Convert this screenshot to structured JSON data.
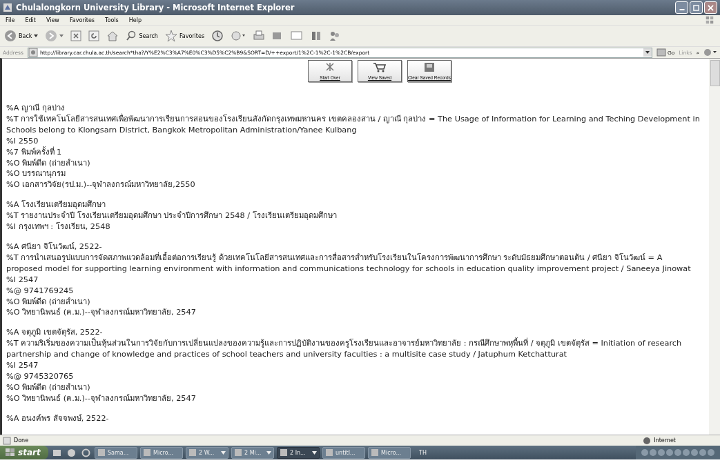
{
  "window": {
    "title": "Chulalongkorn University Library - Microsoft Internet Explorer"
  },
  "menu": [
    "File",
    "Edit",
    "View",
    "Favorites",
    "Tools",
    "Help"
  ],
  "toolbar": {
    "back": "Back",
    "search": "Search",
    "favorites": "Favorites"
  },
  "address": {
    "label": "Address",
    "url": "http://library.car.chula.ac.th/search*tha?/Y%E2%C3%A7%E0%C3%D5%C2%B9&SORT=D/++export/1%2C-1%2C-1%2CB/export",
    "go": "Go",
    "links": "Links",
    "more": "»"
  },
  "page_buttons": [
    {
      "kind": "start",
      "label": "Start Over"
    },
    {
      "kind": "cart",
      "label": "View Saved"
    },
    {
      "kind": "clear",
      "label": "Clear Saved Records"
    }
  ],
  "records": [
    {
      "lines": [
        "%A ญาณี กุลบ่าง",
        "%T การใช้เทคโนโลยีสารสนเทศเพื่อพัฒนาการเรียนการสอนของโรงเรียนสังกัดกรุงเทพมหานคร เขตคลองสาน / ญาณี กุลบ่าง = The Usage of Information for Learning and Teching Development in Schools belong to Klongsarn District, Bangkok Metropolitan Administration/Yanee Kulbang",
        "%I 2550",
        "%7 พิมพ์ครั้งที่ 1",
        "%O พิมพ์ดีด (ถ่ายสำเนา)",
        "%O บรรณานุกรม",
        "%O เอกสารวิจัย(รป.ม.)--จุฬาลงกรณ์มหาวิทยาลัย,2550"
      ]
    },
    {
      "lines": [
        "%A โรงเรียนเตรียมอุดมศึกษา",
        "%T รายงานประจำปี โรงเรียนเตรียมอุดมศึกษา ประจำปีการศึกษา 2548 / โรงเรียนเตรียมอุดมศึกษา",
        "%I กรุงเทพฯ : โรงเรียน, 2548"
      ]
    },
    {
      "lines": [
        "%A ศนียา จิโนวัฒน์, 2522-",
        "%T การนำเสนอรูปแบบการจัดสภาพแวดล้อมที่เอื้อต่อการเรียนรู้ ด้วยเทคโนโลยีสารสนเทศและการสื่อสารสำหรับโรงเรียนในโครงการพัฒนาการศึกษา ระดับมัธยมศึกษาตอนต้น / ศนียา จิโนวัฒน์ = A proposed model for supporting learning environment with information and communications technology for schools in education quality improvement project / Saneeya Jinowat",
        "%I 2547",
        "%@ 9741769245",
        "%O พิมพ์ดีด (ถ่ายสำเนา)",
        "%O วิทยานิพนธ์ (ค.ม.)--จุฬาลงกรณ์มหาวิทยาลัย, 2547"
      ]
    },
    {
      "lines": [
        "%A จตุภูมิ เขตจัตุรัส, 2522-",
        "%T ความริเริ่มของความเป็นหุ้นส่วนในการวิจัยกับการเปลี่ยนแปลงของความรู้และการปฏิบัติงานของครูโรงเรียนและอาจารย์มหาวิทยาลัย : กรณีศึกษาพหุพื้นที่ / จตุภูมิ เขตจัตุรัส = Initiation of research partnership and change of knowledge and practices of school teachers and university faculties : a multisite case study / Jatuphum Ketchatturat",
        "%I 2547",
        "%@ 9745320765",
        "%O พิมพ์ดีด (ถ่ายสำเนา)",
        "%O วิทยานิพนธ์ (ค.ม.)--จุฬาลงกรณ์มหาวิทยาลัย, 2547"
      ]
    },
    {
      "lines": [
        "%A อนงค์พร สัจจพงษ์, 2522-"
      ]
    }
  ],
  "status_bar": {
    "text": "Done",
    "zone": "Internet"
  },
  "taskbar": {
    "start": "start",
    "tasks": [
      {
        "label": "Sama...",
        "grouped": false,
        "selected": false
      },
      {
        "label": "Micro...",
        "grouped": false,
        "selected": false
      },
      {
        "label": "2 W...",
        "grouped": true,
        "selected": false
      },
      {
        "label": "2 Mi...",
        "grouped": true,
        "selected": false
      },
      {
        "label": "2 In...",
        "grouped": true,
        "selected": true
      },
      {
        "label": "untitl...",
        "grouped": false,
        "selected": false
      },
      {
        "label": "Micro...",
        "grouped": false,
        "selected": false
      }
    ],
    "lang": "TH"
  }
}
